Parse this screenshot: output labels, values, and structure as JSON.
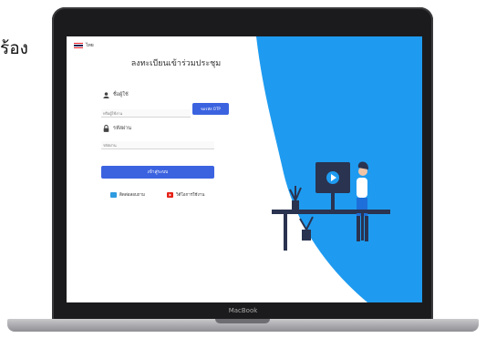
{
  "left_text": "ร้อง",
  "laptop_brand": "MacBook",
  "screen": {
    "language": "ไทย",
    "title": "ลงทะเบียนเข้าร่วมประชุม",
    "username": {
      "label": "ชื่อผู้ใช้",
      "placeholder": "หรือผู้ใช้งาน"
    },
    "otp_button": "ขอรหัส OTP",
    "password": {
      "label": "รหัสผ่าน",
      "placeholder": "รหัสผ่าน"
    },
    "login_button": "เข้าสู่ระบบ",
    "links": {
      "contact": "ติดต่อสอบถาม",
      "video": "วิดีโอการใช้งาน"
    },
    "colors": {
      "accent": "#3b63e0",
      "blob": "#1e9bf0",
      "youtube": "#e62117"
    }
  }
}
